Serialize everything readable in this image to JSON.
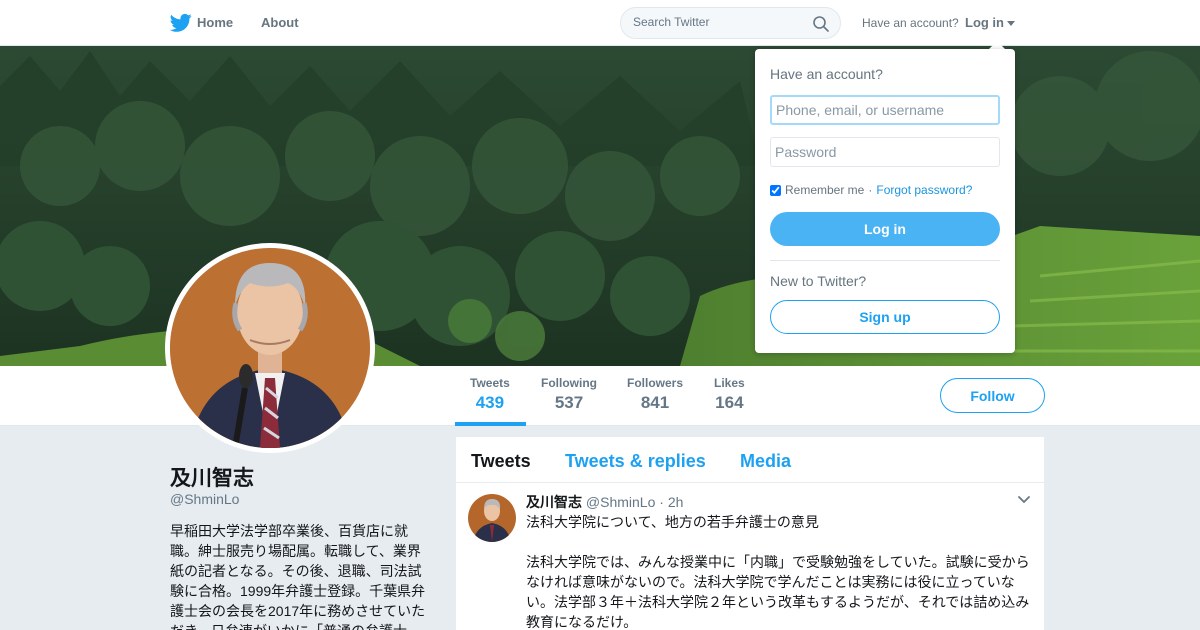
{
  "nav": {
    "home_label": "Home",
    "about_label": "About",
    "search_placeholder": "Search Twitter",
    "have_account": "Have an account?",
    "login_label": "Log in"
  },
  "login_dropdown": {
    "title": "Have an account?",
    "username_placeholder": "Phone, email, or username",
    "password_placeholder": "Password",
    "remember_me": "Remember me",
    "separator": " · ",
    "forgot_password": "Forgot password?",
    "login_button": "Log in",
    "new_to_twitter": "New to Twitter?",
    "signup_button": "Sign up"
  },
  "profile_nav": {
    "stats": [
      {
        "label": "Tweets",
        "value": "439"
      },
      {
        "label": "Following",
        "value": "537"
      },
      {
        "label": "Followers",
        "value": "841"
      },
      {
        "label": "Likes",
        "value": "164"
      }
    ],
    "follow_button": "Follow"
  },
  "profile": {
    "name": "及川智志",
    "handle": "@ShminLo",
    "bio": "早稲田大学法学部卒業後、百貨店に就職。紳士服売り場配属。転職して、業界紙の記者となる。その後、退職、司法試験に合格。1999年弁護士登録。千葉県弁護士会の会長を2017年に務めさせていただき、日弁連がいかに「普通の弁護士"
  },
  "timeline": {
    "tabs": [
      "Tweets",
      "Tweets & replies",
      "Media"
    ],
    "tweet": {
      "name": "及川智志",
      "handle": "@ShminLo",
      "time": "2h",
      "line1": "法科大学院について、地方の若手弁護士の意見",
      "line2": "法科大学院では、みんな授業中に「内職」で受験勉強をしていた。試験に受からなければ意味がないので。法科大学院で学んだことは実務には役に立っていない。法学部３年＋法科大学院２年という改革もするようだが、それでは詰め込み教育になるだけ。"
    }
  },
  "colors": {
    "accent": "#1da1f2",
    "login_button": "#4ab3f4",
    "muted_text": "#657786",
    "background": "#e6ecf0"
  },
  "icons": [
    "twitter-bird-icon",
    "home-icon",
    "search-icon",
    "chevron-down-icon"
  ]
}
